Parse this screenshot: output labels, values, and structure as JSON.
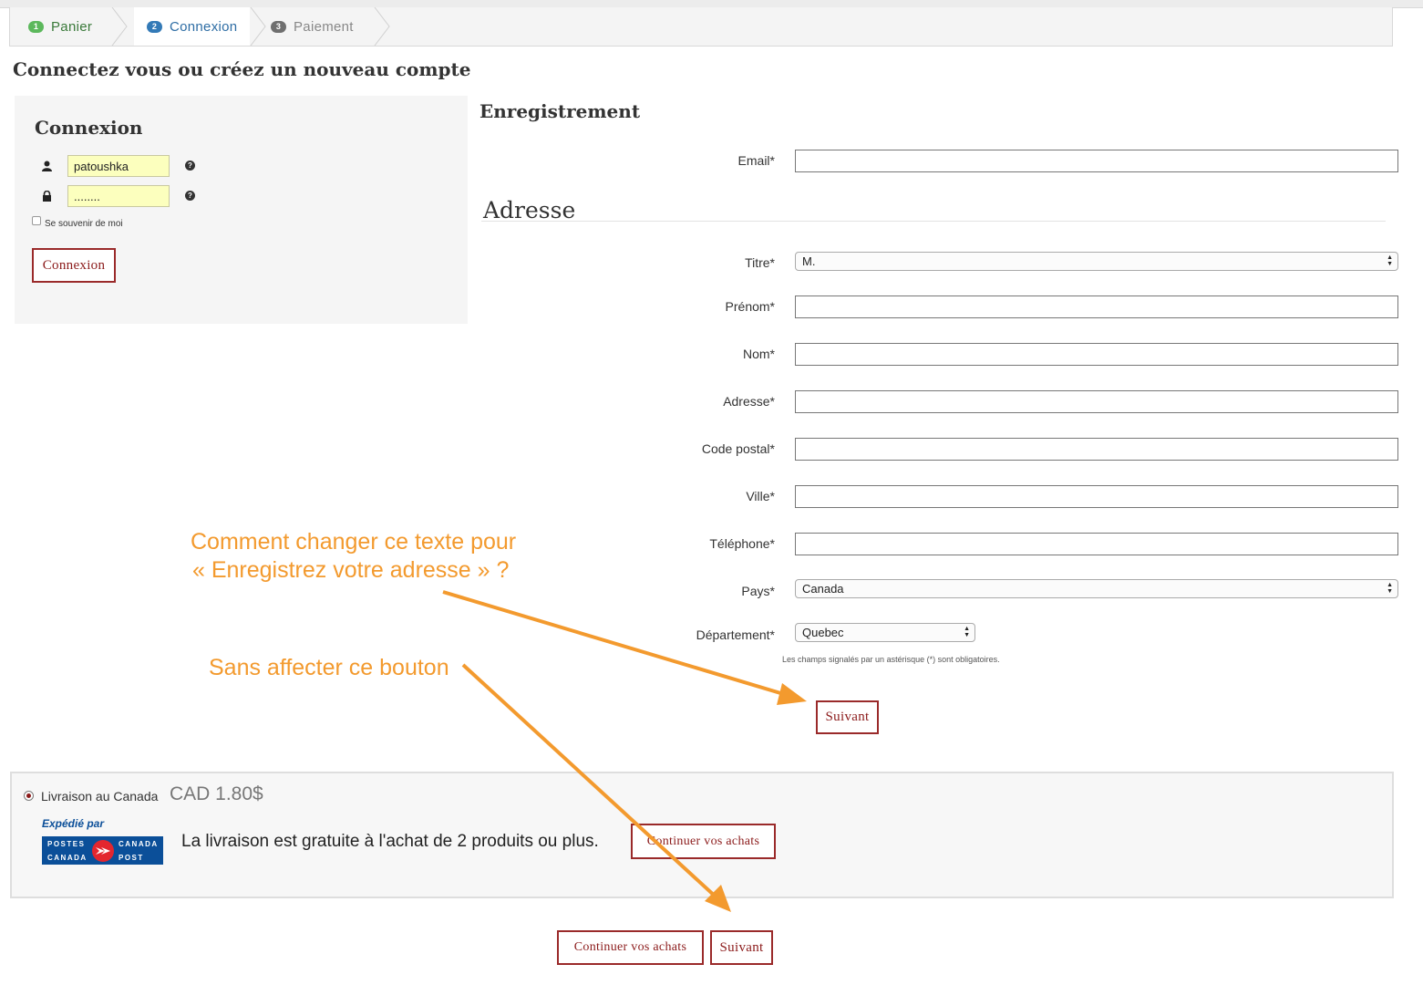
{
  "steps": [
    {
      "num": "1",
      "label": "Panier",
      "color": "#5cb85c",
      "text_color": "#3a7a3a"
    },
    {
      "num": "2",
      "label": "Connexion",
      "color": "#337ab7",
      "text_color": "#2e6da4"
    },
    {
      "num": "3",
      "label": "Paiement",
      "color": "#6f6f6f",
      "text_color": "#888888"
    }
  ],
  "page_heading": "Connectez vous ou créez un nouveau compte",
  "login": {
    "title": "Connexion",
    "username_value": "patoushka",
    "password_value": "........",
    "remember_label": "Se souvenir de moi",
    "help_glyph": "?",
    "button_label": "Connexion"
  },
  "registration": {
    "title": "Enregistrement",
    "email_label": "Email*",
    "address_heading": "Adresse",
    "fields": {
      "titre": {
        "label": "Titre*",
        "value": "M."
      },
      "prenom": {
        "label": "Prénom*"
      },
      "nom": {
        "label": "Nom*"
      },
      "adresse": {
        "label": "Adresse*"
      },
      "code_postal": {
        "label": "Code postal*"
      },
      "ville": {
        "label": "Ville*"
      },
      "telephone": {
        "label": "Téléphone*"
      },
      "pays": {
        "label": "Pays*",
        "value": "Canada"
      },
      "departement": {
        "label": "Département*",
        "value": "Quebec"
      }
    },
    "required_note": "Les champs signalés par un astérisque (*) sont obligatoires.",
    "next_button": "Suivant"
  },
  "shipping": {
    "option_label": "Livraison au Canada",
    "price": "CAD 1.80$",
    "shipped_by": "Expédié par",
    "logo_text": {
      "postes": "POSTES",
      "canada_fr": "CANADA",
      "canada_en": "CANADA",
      "post": "POST"
    },
    "free_shipping_text": "La livraison est gratuite à l'achat de 2 produits ou plus.",
    "continue_button": "Continuer vos achats"
  },
  "footer": {
    "continue_button": "Continuer vos achats",
    "next_button": "Suivant"
  },
  "annotations": {
    "line1": "Comment changer ce texte pour",
    "line2": "«  Enregistrez votre adresse » ?",
    "line3": "Sans affecter ce bouton"
  },
  "colors": {
    "accent_red": "#8b1a1a",
    "annotation_orange": "#f39a2e",
    "autofill_yellow": "#fcffbe",
    "canada_post_blue": "#0b4f99"
  }
}
